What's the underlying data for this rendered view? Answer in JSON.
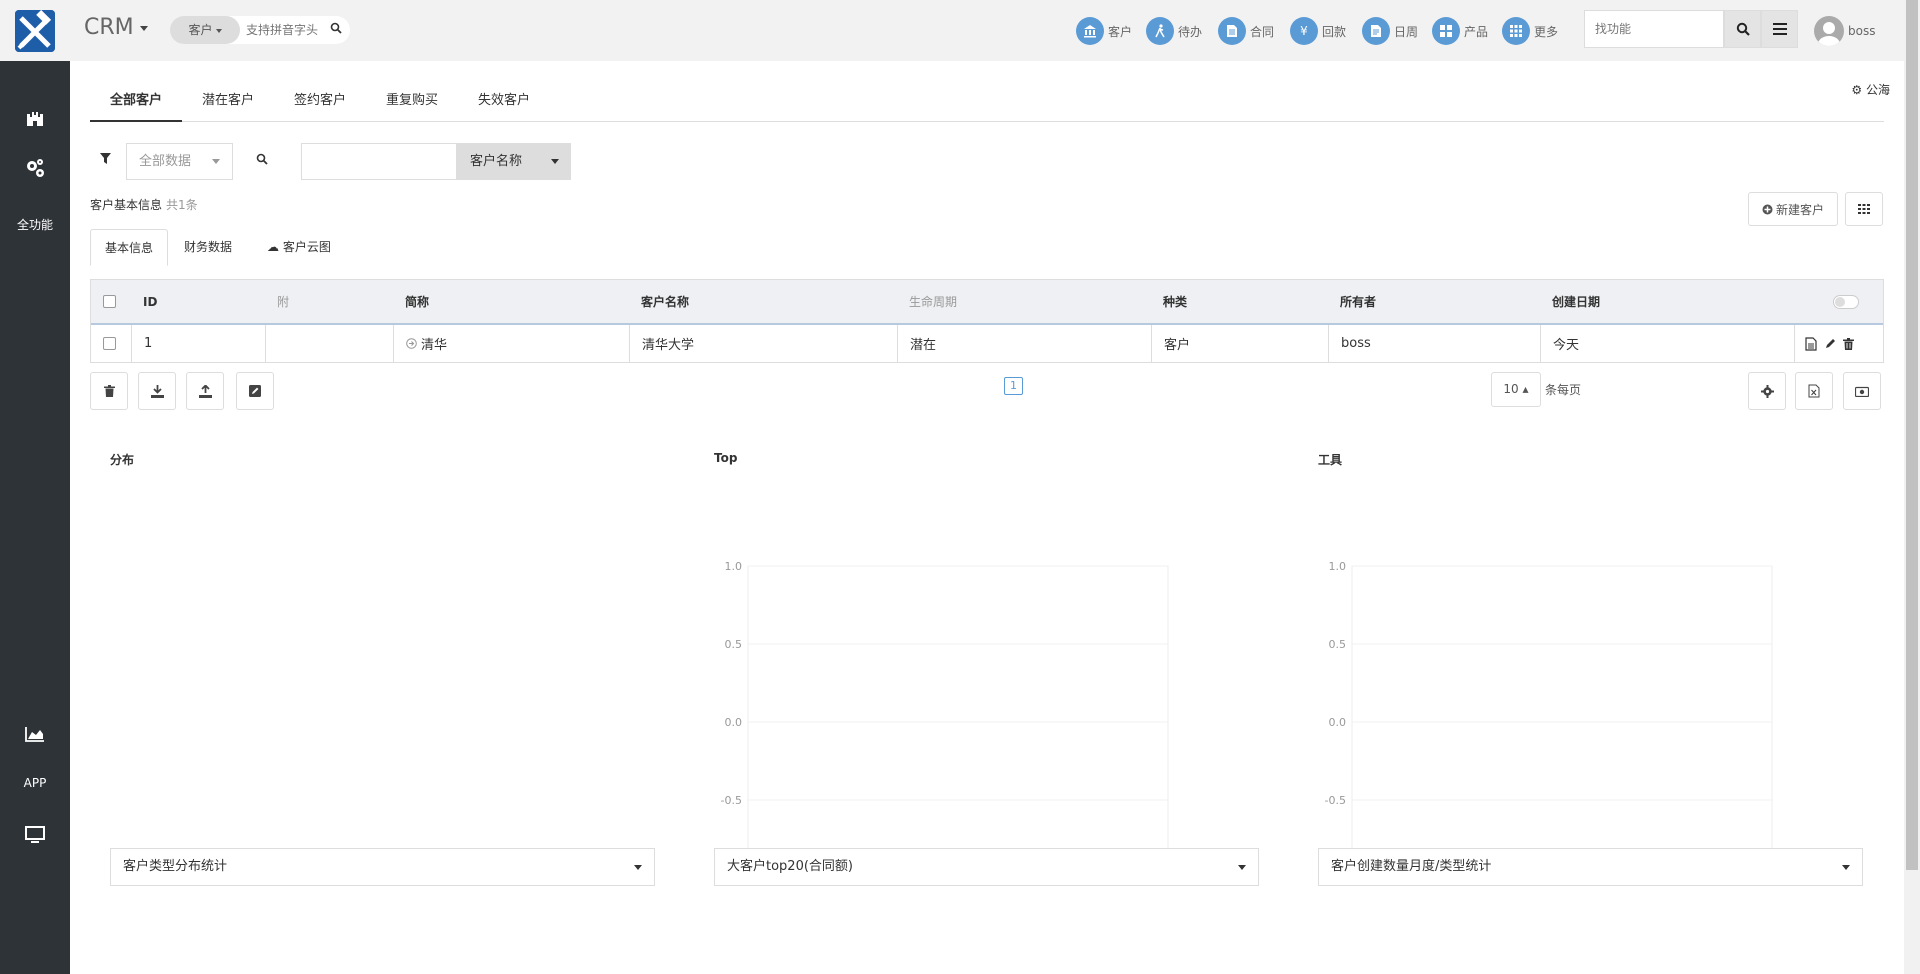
{
  "header": {
    "app_title": "CRM",
    "quick_search": {
      "type_label": "客户",
      "placeholder": "支持拼音字头"
    },
    "nav": [
      {
        "label": "客户",
        "icon": "bank-icon"
      },
      {
        "label": "待办",
        "icon": "walk-icon"
      },
      {
        "label": "合同",
        "icon": "document-icon"
      },
      {
        "label": "回款",
        "icon": "yen-icon"
      },
      {
        "label": "日周",
        "icon": "report-icon"
      },
      {
        "label": "产品",
        "icon": "grid-icon"
      },
      {
        "label": "更多",
        "icon": "more-icon"
      }
    ],
    "find_placeholder": "找功能",
    "user_name": "boss",
    "accent_color": "#5b9bd5"
  },
  "sidebar": {
    "items": [
      {
        "label": "",
        "icon": "castle-icon"
      },
      {
        "label": "",
        "icon": "gears-icon"
      },
      {
        "label": "全功能",
        "icon": ""
      },
      {
        "label": "",
        "icon": "area-chart-icon"
      },
      {
        "label": "APP",
        "icon": ""
      },
      {
        "label": "",
        "icon": "monitor-icon"
      }
    ]
  },
  "tabs": [
    "全部客户",
    "潜在客户",
    "签约客户",
    "重复购买",
    "失效客户"
  ],
  "public_sea_label": "公海",
  "filter": {
    "scope_placeholder": "全部数据",
    "search_field": "客户名称"
  },
  "info": {
    "label": "客户基本信息",
    "count": "共1条"
  },
  "new_customer_label": "新建客户",
  "subtabs": [
    "基本信息",
    "财务数据",
    "客户云图"
  ],
  "table": {
    "headers": [
      "ID",
      "附",
      "简称",
      "客户名称",
      "生命周期",
      "种类",
      "所有者",
      "创建日期"
    ],
    "rows": [
      [
        "1",
        "",
        "清华",
        "清华大学",
        "潜在",
        "客户",
        "boss",
        "今天"
      ]
    ]
  },
  "pagination": {
    "current_page": "1",
    "page_size": "10",
    "page_size_label": "条每页"
  },
  "panels": [
    {
      "title": "分布",
      "select": "客户类型分布统计"
    },
    {
      "title": "Top",
      "select": "大客户top20(合同额)"
    },
    {
      "title": "工具",
      "select": "客户创建数量月度/类型统计"
    }
  ],
  "chart_data": [
    {
      "type": "bar",
      "title": "Top",
      "categories": [],
      "values": [],
      "ylim": [
        -1.0,
        1.0
      ],
      "yticks": [
        "1.0",
        "0.5",
        "0.0",
        "-0.5",
        "-1.0"
      ],
      "grid": true
    },
    {
      "type": "bar",
      "title": "工具",
      "categories": [],
      "values": [],
      "ylim": [
        -1.0,
        1.0
      ],
      "yticks": [
        "1.0",
        "0.5",
        "0.0",
        "-0.5",
        "-1.0"
      ],
      "grid": true
    }
  ]
}
